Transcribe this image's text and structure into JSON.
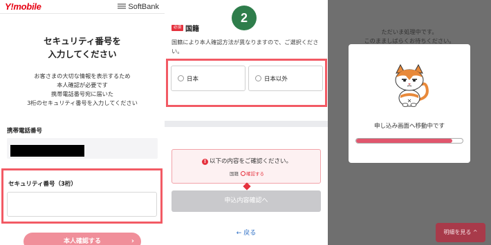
{
  "panel1": {
    "brand_left": "Y!mobile",
    "brand_right": "SoftBank",
    "title_line1": "セキュリティ番号を",
    "title_line2": "入力してください",
    "desc_lines": [
      "お客さまの大切な情報を表示するため",
      "本人確認が必要です",
      "携帯電話番号宛に届いた",
      "3桁のセキュリティ番号を入力してください"
    ],
    "phone_label": "携帯電話番号",
    "security_label": "セキュリティ番号（3桁）",
    "security_value": "",
    "confirm_button": "本人確認する",
    "confirm_chevron": "›"
  },
  "panel2": {
    "step_number": "2",
    "required_badge": "必須",
    "nationality_title": "国籍",
    "nationality_desc": "国籍により本人確認方法が異なりますので、ご選択ください。",
    "options": [
      {
        "label": "日本"
      },
      {
        "label": "日本以外"
      }
    ],
    "alert_icon": "!",
    "alert_title": "以下の内容をご確認ください。",
    "alert_sub_prefix": "国籍",
    "alert_sub_link": "確認する",
    "confirm_button": "申込内容確認へ",
    "back_link": "← 戻る"
  },
  "panel3": {
    "bg_line1": "ただいま処理中です。",
    "bg_line2": "このまましばらくお待ちください。",
    "modal_text": "申し込み画面へ移動中です",
    "progress_fraction": 0.9,
    "details_button": "明細を見る ^"
  },
  "colors": {
    "brand_red": "#e60012",
    "highlight_red": "#f25a64",
    "step_green": "#2e7d4b",
    "progress_pink": "#e1566d"
  }
}
